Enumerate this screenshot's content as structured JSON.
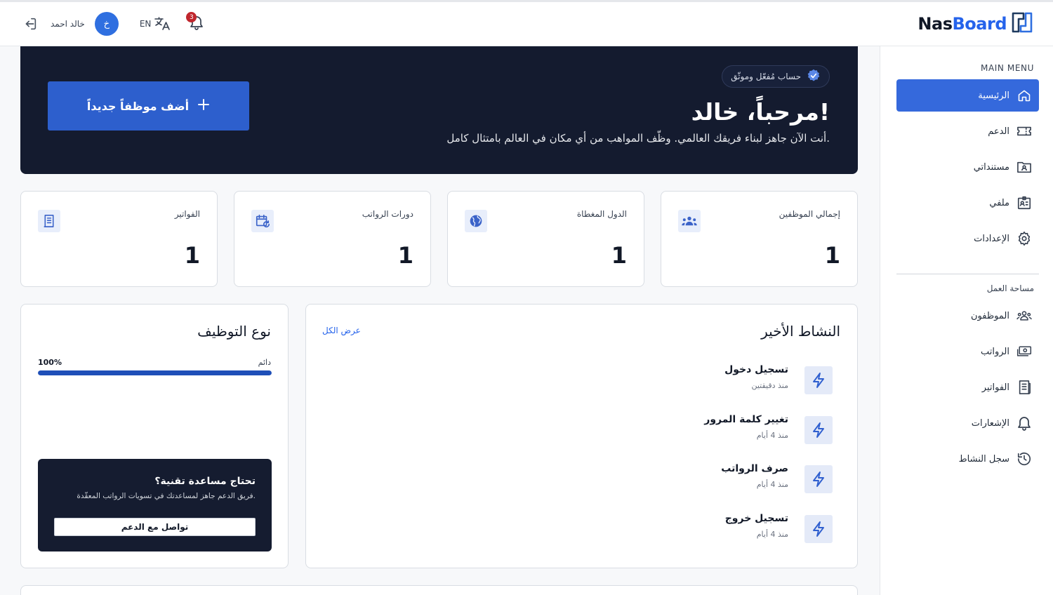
{
  "brand": {
    "name_part1": "Nas",
    "name_part2": "Board",
    "accent": "#2563eb"
  },
  "header": {
    "user_name": "خالد احمد",
    "avatar_initial": "خ",
    "language": "EN",
    "notifications_count": "3"
  },
  "sidebar": {
    "main_menu_heading": "MAIN MENU",
    "main_items": [
      {
        "label": "الرئيسية",
        "icon": "home-icon",
        "active": true
      },
      {
        "label": "الدعم",
        "icon": "ticket-icon"
      },
      {
        "label": "مستنداتي",
        "icon": "folder-user-icon"
      },
      {
        "label": "ملفي",
        "icon": "id-card-icon"
      },
      {
        "label": "الإعدادات",
        "icon": "gear-icon"
      }
    ],
    "workspace_heading": "مساحة العمل",
    "workspace_items": [
      {
        "label": "الموظفون",
        "icon": "users-icon"
      },
      {
        "label": "الرواتب",
        "icon": "money-icon"
      },
      {
        "label": "الفواتير",
        "icon": "receipt-icon"
      },
      {
        "label": "الإشعارات",
        "icon": "bell-icon"
      },
      {
        "label": "سجل النشاط",
        "icon": "history-icon"
      }
    ]
  },
  "hero": {
    "verified_badge": "حساب مُفعّل وموثّق",
    "title": "مرحباً، خالد!",
    "subtitle": "أنت الآن جاهز لبناء فريقك العالمي. وظّف المواهب من أي مكان في العالم بامتثال كامل.",
    "add_button": "أضف موظفاً جديداً"
  },
  "stats": [
    {
      "label": "إجمالي الموظفين",
      "value": "1",
      "icon": "users-icon"
    },
    {
      "label": "الدول المغطاة",
      "value": "1",
      "icon": "globe-icon"
    },
    {
      "label": "دورات الرواتب",
      "value": "1",
      "icon": "calendar-refresh-icon"
    },
    {
      "label": "الفواتير",
      "value": "1",
      "icon": "receipt-icon"
    }
  ],
  "activity": {
    "title": "النشاط الأخير",
    "view_all": "عرض الكل",
    "items": [
      {
        "name": "تسجيل دخول",
        "time": "منذ دقيقتين"
      },
      {
        "name": "تغيير كلمة المرور",
        "time": "منذ 4 أيام"
      },
      {
        "name": "صرف الرواتب",
        "time": "منذ 4 أيام"
      },
      {
        "name": "تسجيل خروج",
        "time": "منذ 4 أيام"
      }
    ]
  },
  "employment": {
    "title": "نوع التوظيف",
    "type_label": "دائم",
    "percent_label": "100%",
    "fill_fraction": 1.0
  },
  "support": {
    "title": "تحتاج مساعدة تقنية؟",
    "subtitle": "فريق الدعم جاهز لمساعدتك في تسويات الرواتب المعقّدة.",
    "button": "تواصل مع الدعم"
  }
}
